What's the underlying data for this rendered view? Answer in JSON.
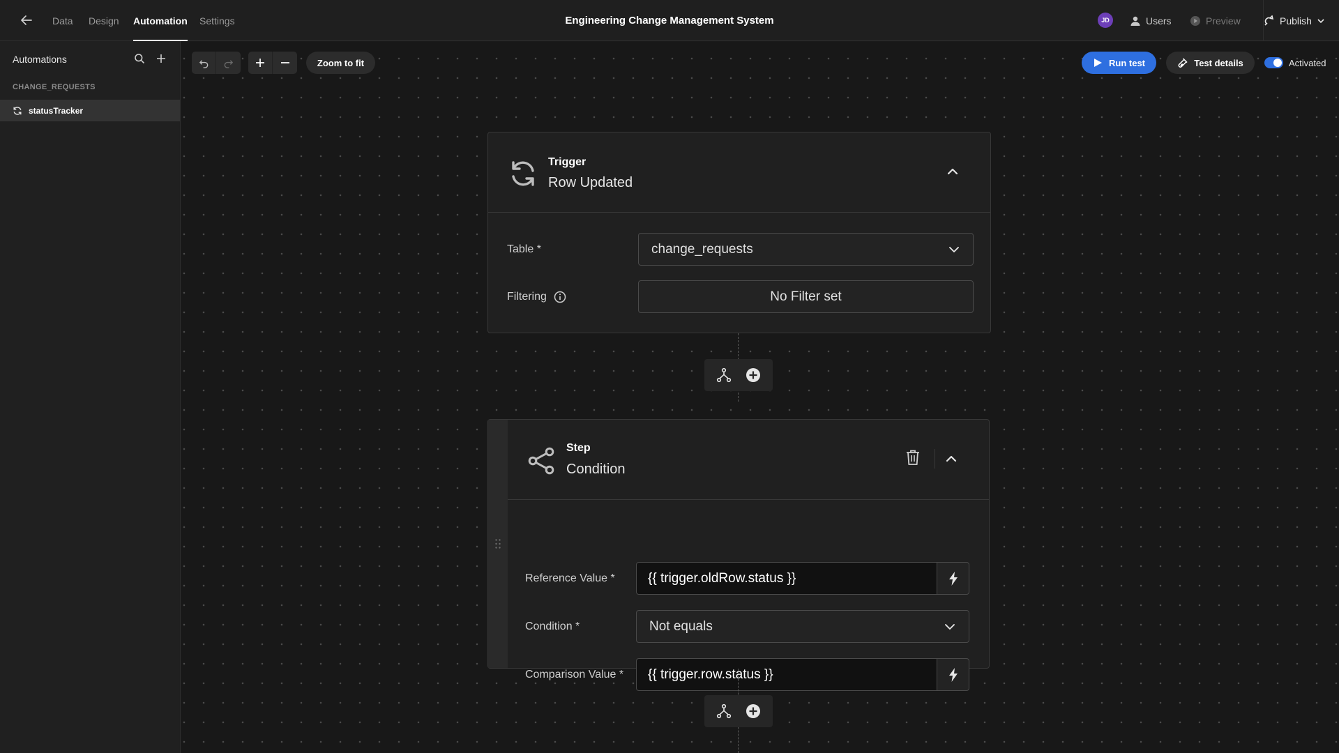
{
  "topbar": {
    "nav": [
      "Data",
      "Design",
      "Automation",
      "Settings"
    ],
    "active_tab": "Automation",
    "title": "Engineering Change Management System",
    "avatar_initials": "JD",
    "users_label": "Users",
    "preview_label": "Preview",
    "publish_label": "Publish"
  },
  "sidebar": {
    "heading": "Automations",
    "group": "CHANGE_REQUESTS",
    "items": [
      {
        "label": "statusTracker"
      }
    ]
  },
  "toolbar": {
    "zoom_to_fit": "Zoom to fit",
    "run_test": "Run test",
    "test_details": "Test details",
    "activated_label": "Activated"
  },
  "trigger": {
    "type": "Trigger",
    "name": "Row Updated",
    "table_label": "Table *",
    "table_value": "change_requests",
    "filtering_label": "Filtering",
    "filter_value": "No Filter set"
  },
  "step": {
    "type": "Step",
    "name": "Condition",
    "reference_label": "Reference Value *",
    "reference_value": "{{ trigger.oldRow.status }}",
    "condition_label": "Condition *",
    "condition_value": "Not equals",
    "comparison_label": "Comparison Value *",
    "comparison_value": "{{ trigger.row.status }}"
  },
  "colors": {
    "accent": "#2e6fe0",
    "avatar": "#6d3fb8",
    "canvas": "#181818",
    "card": "#202020"
  }
}
